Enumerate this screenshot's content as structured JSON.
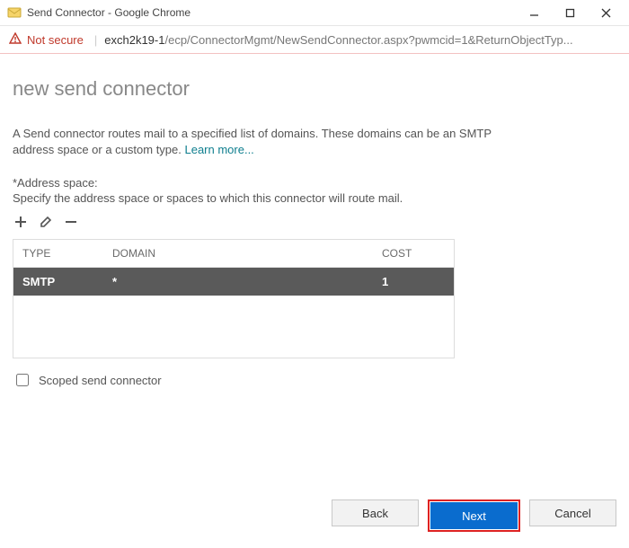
{
  "window": {
    "title": "Send Connector - Google Chrome"
  },
  "address_bar": {
    "security_label": "Not secure",
    "host": "exch2k19-1",
    "path": "/ecp/ConnectorMgmt/NewSendConnector.aspx?pwmcid=1&ReturnObjectTyp..."
  },
  "page": {
    "title": "new send connector",
    "description": "A Send connector routes mail to a specified list of domains. These domains can be an SMTP address space or a custom type. ",
    "learn_more": "Learn more...",
    "section_heading": "*Address space:",
    "section_sub": "Specify the address space or spaces to which this connector will route mail."
  },
  "grid": {
    "headers": {
      "type": "TYPE",
      "domain": "DOMAIN",
      "cost": "COST"
    },
    "rows": [
      {
        "type": "SMTP",
        "domain": "*",
        "cost": "1"
      }
    ]
  },
  "scoped": {
    "checked": false,
    "label": "Scoped send connector"
  },
  "buttons": {
    "back": "Back",
    "next": "Next",
    "cancel": "Cancel"
  }
}
